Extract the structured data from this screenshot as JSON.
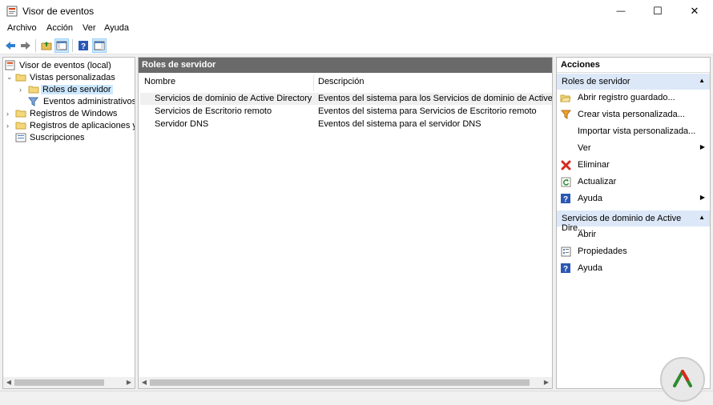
{
  "window": {
    "title": "Visor de eventos",
    "controls": {
      "minimize": "—",
      "maximize": "☐",
      "close": "✕"
    }
  },
  "menu": [
    "Archivo",
    "Acción",
    "Ver",
    "Ayuda"
  ],
  "toolbar": {
    "icons": [
      "back-arrow-icon",
      "forward-arrow-icon",
      "up-folder-icon",
      "console-tree-icon",
      "help-icon",
      "action-pane-icon"
    ]
  },
  "tree": {
    "items": [
      {
        "label": "Visor de eventos (local)",
        "icon": "event-viewer-icon"
      },
      {
        "label": "Vistas personalizadas",
        "icon": "folder-icon",
        "expanded": true
      },
      {
        "label": "Roles de servidor",
        "icon": "folder-icon",
        "selected": true
      },
      {
        "label": "Eventos administrativos",
        "icon": "filter-icon"
      },
      {
        "label": "Registros de Windows",
        "icon": "folder-icon"
      },
      {
        "label": "Registros de aplicaciones y s",
        "icon": "folder-icon"
      },
      {
        "label": "Suscripciones",
        "icon": "subscriptions-icon"
      }
    ]
  },
  "center": {
    "header": "Roles de servidor",
    "columns": [
      "Nombre",
      "Descripción"
    ],
    "rows": [
      {
        "name": "Servicios de dominio de Active Directory",
        "desc": "Eventos del sistema para los Servicios de dominio de Active Directo"
      },
      {
        "name": "Servicios de Escritorio remoto",
        "desc": "Eventos del sistema para Servicios de Escritorio remoto"
      },
      {
        "name": "Servidor DNS",
        "desc": "Eventos del sistema para el servidor DNS"
      }
    ]
  },
  "actions": {
    "title": "Acciones",
    "section1": {
      "label": "Roles de servidor",
      "items": [
        {
          "label": "Abrir registro guardado...",
          "icon": "open-log-icon"
        },
        {
          "label": "Crear vista personalizada...",
          "icon": "filter-icon"
        },
        {
          "label": "Importar vista personalizada...",
          "icon": ""
        },
        {
          "label": "Ver",
          "icon": "",
          "submenu": true
        },
        {
          "label": "Eliminar",
          "icon": "delete-icon"
        },
        {
          "label": "Actualizar",
          "icon": "refresh-icon"
        },
        {
          "label": "Ayuda",
          "icon": "help-icon",
          "submenu": true
        }
      ]
    },
    "section2": {
      "label": "Servicios de dominio de Active Dire...",
      "items": [
        {
          "label": "Abrir",
          "icon": ""
        },
        {
          "label": "Propiedades",
          "icon": "properties-icon"
        },
        {
          "label": "Ayuda",
          "icon": "help-icon"
        }
      ]
    }
  },
  "colors": {
    "accent": "#cce8ff",
    "section_bg": "#dce8f7",
    "pane_header": "#6a6a6a",
    "delete_red": "#d83b01",
    "help_blue": "#2b58b5"
  }
}
